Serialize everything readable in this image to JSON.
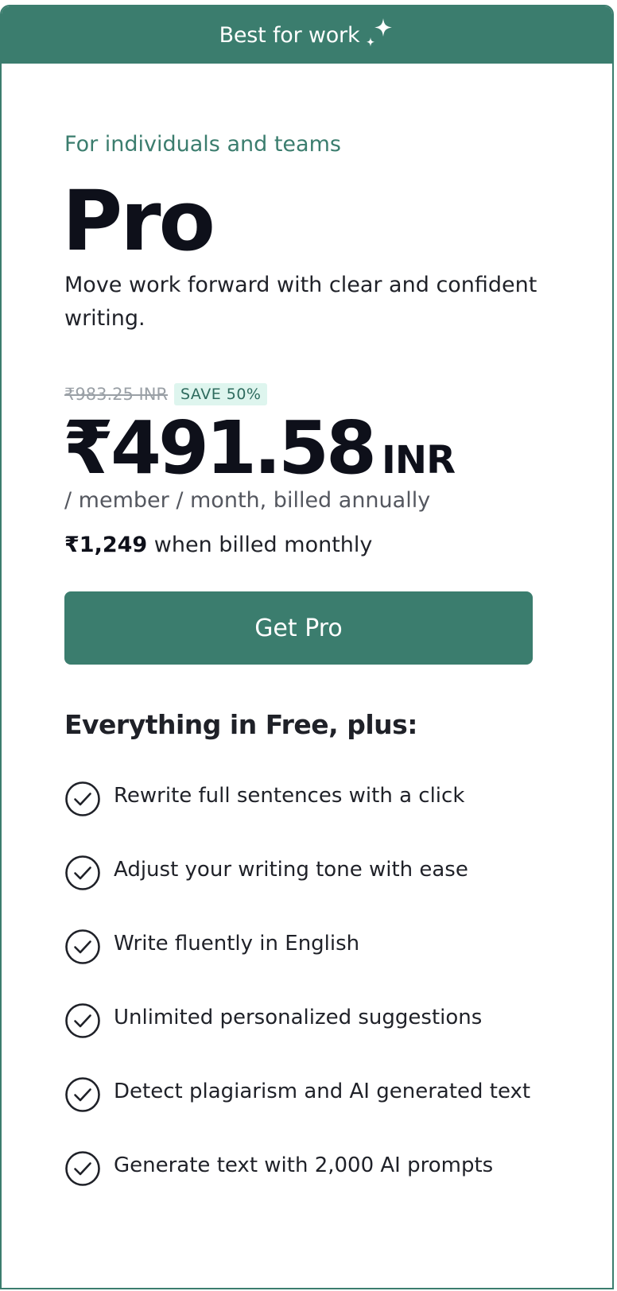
{
  "banner": {
    "label": "Best for work",
    "icon": "sparkle-icon"
  },
  "plan": {
    "eyebrow": "For individuals and teams",
    "name": "Pro",
    "tagline": "Move work forward with clear and confident writing."
  },
  "pricing": {
    "original_price": "₹983.25 INR",
    "save_badge": "SAVE 50%",
    "price": "₹491.58",
    "currency": "INR",
    "period": "/ member / month, billed annually",
    "monthly_amount": "₹1,249",
    "monthly_suffix": " when billed monthly"
  },
  "cta": {
    "label": "Get Pro"
  },
  "features": {
    "title": "Everything in Free, plus:",
    "items": [
      {
        "label": "Rewrite full sentences with a click",
        "icon": "check-circle-icon"
      },
      {
        "label": "Adjust your writing tone with ease",
        "icon": "check-circle-icon"
      },
      {
        "label": "Write fluently in English",
        "icon": "check-circle-icon"
      },
      {
        "label": "Unlimited personalized suggestions",
        "icon": "check-circle-icon"
      },
      {
        "label": "Detect plagiarism and AI generated text",
        "icon": "check-circle-icon"
      },
      {
        "label": "Generate text with 2,000 AI prompts",
        "icon": "check-circle-icon"
      }
    ]
  },
  "colors": {
    "accent": "#3b7d6e",
    "badge_bg": "#def5ee",
    "text": "#0e101a",
    "muted": "#54575f"
  }
}
